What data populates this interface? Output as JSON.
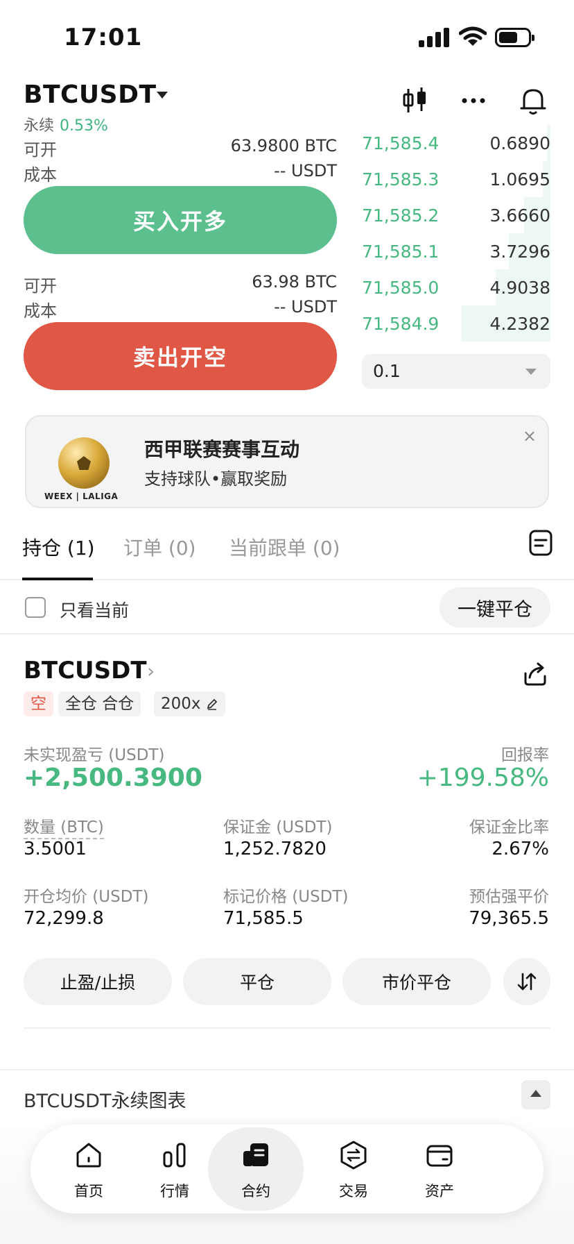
{
  "status_bar": {
    "time": "17:01"
  },
  "header": {
    "symbol": "BTCUSDT",
    "type_label": "永续",
    "change_pct": "0.53%"
  },
  "trade_panel": {
    "long": {
      "available_label": "可开",
      "available_value": "63.9800 BTC",
      "cost_label": "成本",
      "cost_value": "-- USDT",
      "button_label": "买入开多"
    },
    "short": {
      "available_label": "可开",
      "available_value": "63.98 BTC",
      "cost_label": "成本",
      "cost_value": "-- USDT",
      "button_label": "卖出开空"
    }
  },
  "order_book": {
    "bids": [
      {
        "price": "71,585.4",
        "qty": "0.6890",
        "depth": 0.05
      },
      {
        "price": "71,585.3",
        "qty": "1.0695",
        "depth": 0.08
      },
      {
        "price": "71,585.2",
        "qty": "3.6660",
        "depth": 0.3
      },
      {
        "price": "71,585.1",
        "qty": "3.7296",
        "depth": 0.46
      },
      {
        "price": "71,585.0",
        "qty": "4.9038",
        "depth": 0.62
      },
      {
        "price": "71,584.9",
        "qty": "4.2382",
        "depth": 1.0
      }
    ],
    "step_value": "0.1"
  },
  "banner": {
    "brand": "WEEX | LALIGA",
    "title": "西甲联赛赛事互动",
    "subtitle": "支持球队•赢取奖励",
    "close_glyph": "×"
  },
  "tabs": [
    {
      "label": "持仓 (1)"
    },
    {
      "label": "订单 (0)"
    },
    {
      "label": "当前跟单 (0)"
    }
  ],
  "filter": {
    "checkbox_label": "只看当前",
    "close_all_label": "一键平仓"
  },
  "position": {
    "symbol": "BTCUSDT",
    "chevron": "›",
    "tags": {
      "side": "空",
      "mode": "全仓 合仓",
      "leverage": "200x"
    },
    "pnl_label": "未实现盈亏 (USDT)",
    "pnl_value": "+2,500.3900",
    "roe_label": "回报率",
    "roe_value": "+199.58%",
    "metrics": [
      {
        "label": "数量 (BTC)",
        "value": "3.5001"
      },
      {
        "label": "保证金 (USDT)",
        "value": "1,252.7820"
      },
      {
        "label": "保证金比率",
        "value": "2.67%"
      },
      {
        "label": "开仓均价 (USDT)",
        "value": "72,299.8"
      },
      {
        "label": "标记价格 (USDT)",
        "value": "71,585.5"
      },
      {
        "label": "预估强平价",
        "value": "79,365.5"
      }
    ],
    "actions": {
      "tp_sl": "止盈/止损",
      "close": "平仓",
      "market_close": "市价平仓"
    }
  },
  "chart_section": {
    "title": "BTCUSDT永续图表"
  },
  "nav": [
    {
      "label": "首页",
      "icon": "home-icon"
    },
    {
      "label": "行情",
      "icon": "markets-icon"
    },
    {
      "label": "合约",
      "icon": "futures-icon",
      "active": true
    },
    {
      "label": "交易",
      "icon": "trade-icon"
    },
    {
      "label": "资产",
      "icon": "wallet-icon"
    }
  ]
}
